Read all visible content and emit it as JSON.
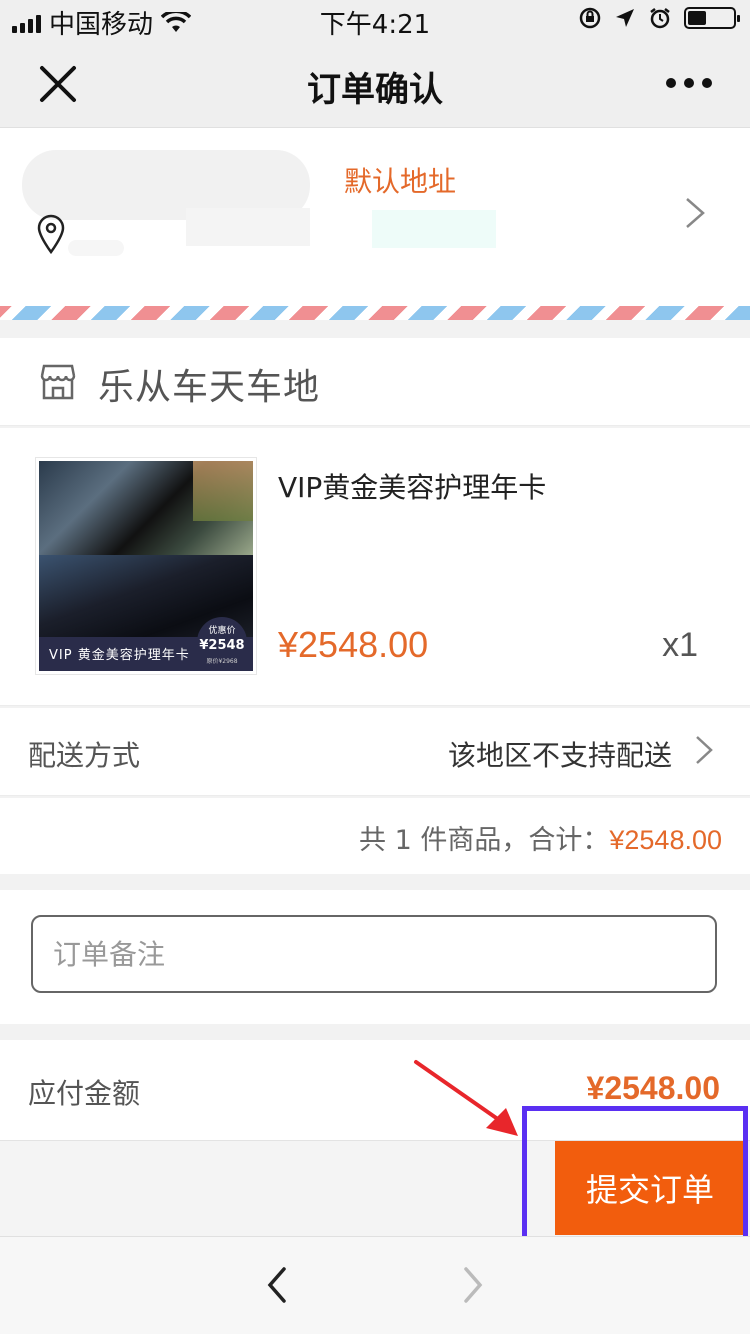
{
  "status_bar": {
    "carrier": "中国移动",
    "time": "下午4:21",
    "battery_level": 0.4,
    "icons": [
      "signal-icon",
      "wifi-icon",
      "orientation-lock-icon",
      "location-icon",
      "alarm-icon",
      "battery-icon"
    ]
  },
  "nav": {
    "title": "订单确认",
    "icons": [
      "close-icon",
      "more-icon"
    ]
  },
  "address": {
    "default_label": "默认地址",
    "icons": [
      "location-pin-icon",
      "chevron-right-icon"
    ]
  },
  "shop": {
    "name": "乐从车天车地",
    "icon": "store-icon"
  },
  "product": {
    "title": "VIP黄金美容护理年卡",
    "price": "¥2548.00",
    "quantity": "x1",
    "image": {
      "caption": "VIP 黄金美容护理年卡",
      "badge_label": "优惠价",
      "badge_price": "¥2548",
      "badge_small": "原价¥2968"
    }
  },
  "delivery": {
    "label": "配送方式",
    "value": "该地区不支持配送"
  },
  "summary": {
    "text": "共 1 件商品，合计：",
    "amount": "¥2548.00"
  },
  "remark": {
    "placeholder": "订单备注",
    "value": ""
  },
  "payable": {
    "label": "应付金额",
    "amount": "¥2548.00"
  },
  "footer": {
    "submit_label": "提交订单"
  },
  "browser": {
    "icons": [
      "back-arrow-icon",
      "forward-arrow-icon"
    ]
  },
  "colors": {
    "accent_orange": "#e4692a",
    "submit_button": "#f25d0d",
    "highlight_box": "#5a2ff2",
    "arrow_red": "#e8262b"
  }
}
